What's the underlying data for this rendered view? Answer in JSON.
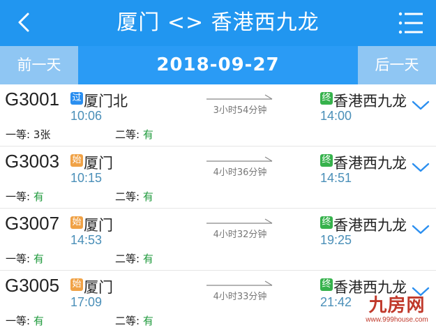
{
  "header": {
    "title": "厦门 <> 香港西九龙",
    "back_icon": "chevron-left-icon",
    "menu_icon": "list-menu-icon"
  },
  "datebar": {
    "prev_label": "前一天",
    "date": "2018-09-27",
    "next_label": "后一天"
  },
  "trains": [
    {
      "number": "G3001",
      "dep_badge": "过",
      "dep_badge_type": "pass",
      "dep_station": "厦门北",
      "dep_time": "10:06",
      "duration": "3小时54分钟",
      "arr_badge": "终",
      "arr_station": "香港西九龙",
      "arr_time": "14:00",
      "first_class_label": "一等:",
      "first_class": "3张",
      "second_class_label": "二等:",
      "second_class": "有"
    },
    {
      "number": "G3003",
      "dep_badge": "始",
      "dep_badge_type": "start",
      "dep_station": "厦门",
      "dep_time": "10:15",
      "duration": "4小时36分钟",
      "arr_badge": "终",
      "arr_station": "香港西九龙",
      "arr_time": "14:51",
      "first_class_label": "一等:",
      "first_class": "有",
      "second_class_label": "二等:",
      "second_class": "有"
    },
    {
      "number": "G3007",
      "dep_badge": "始",
      "dep_badge_type": "start",
      "dep_station": "厦门",
      "dep_time": "14:53",
      "duration": "4小时32分钟",
      "arr_badge": "终",
      "arr_station": "香港西九龙",
      "arr_time": "19:25",
      "first_class_label": "一等:",
      "first_class": "有",
      "second_class_label": "二等:",
      "second_class": "有"
    },
    {
      "number": "G3005",
      "dep_badge": "始",
      "dep_badge_type": "start",
      "dep_station": "厦门",
      "dep_time": "17:09",
      "duration": "4小时33分钟",
      "arr_badge": "终",
      "arr_station": "香港西九龙",
      "arr_time": "21:42",
      "first_class_label": "一等:",
      "first_class": "有",
      "second_class_label": "二等:",
      "second_class": "有"
    }
  ],
  "watermark": {
    "logo": "九房网",
    "url": "www.999house.com"
  },
  "colors": {
    "header_bg": "#2196f0",
    "day_button_bg": "#8fc6f3",
    "time_color": "#4a8fb8",
    "available_color": "#1f9a3c",
    "badge_pass": "#2b8ff0",
    "badge_start": "#f0a246",
    "badge_end": "#36b24c",
    "chevron_color": "#2b8ff0"
  }
}
